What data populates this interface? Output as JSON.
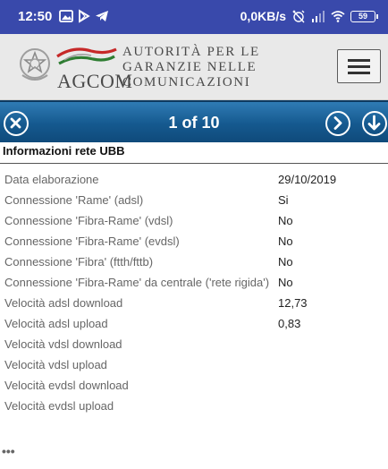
{
  "status_bar": {
    "time": "12:50",
    "left_icons": [
      "gallery-icon",
      "play-store-icon",
      "telegram-icon"
    ],
    "net_speed": "0,0KB/s",
    "right_icons": [
      "alarm-off-icon",
      "signal-icon",
      "wifi-icon"
    ],
    "battery": "59"
  },
  "header": {
    "logo_short": "AGCOM",
    "logo_line1": "AUTORITÀ PER LE",
    "logo_line2": "GARANZIE NELLE",
    "logo_line3": "COMUNICAZIONI",
    "colors": {
      "red": "#c62828",
      "green": "#2e7d32"
    }
  },
  "navbar": {
    "page_indicator": "1 of 10"
  },
  "section": {
    "title": "Informazioni rete UBB"
  },
  "rows": [
    {
      "label": "Data elaborazione",
      "value": "29/10/2019"
    },
    {
      "label": "Connessione 'Rame' (adsl)",
      "value": "Si"
    },
    {
      "label": "Connessione 'Fibra-Rame' (vdsl)",
      "value": "No"
    },
    {
      "label": "Connessione 'Fibra-Rame' (evdsl)",
      "value": "No"
    },
    {
      "label": "Connessione 'Fibra' (ftth/fttb)",
      "value": "No"
    },
    {
      "label": "Connessione 'Fibra-Rame' da centrale ('rete rigida')",
      "value": "No"
    },
    {
      "label": "Velocità adsl download",
      "value": "12,73"
    },
    {
      "label": "Velocità adsl upload",
      "value": "0,83"
    },
    {
      "label": "Velocità vdsl download",
      "value": ""
    },
    {
      "label": "Velocità vdsl upload",
      "value": ""
    },
    {
      "label": "Velocità evdsl download",
      "value": ""
    },
    {
      "label": "Velocità evdsl upload",
      "value": ""
    }
  ],
  "footer": {
    "more": "•••"
  }
}
